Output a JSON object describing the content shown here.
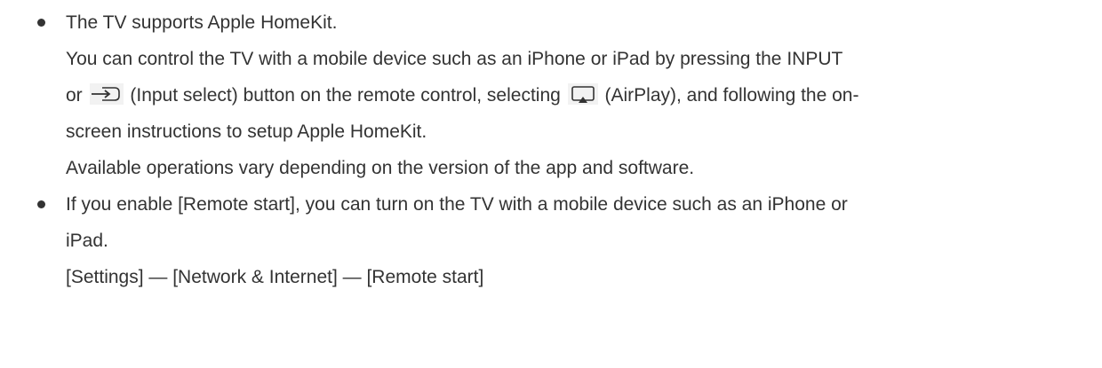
{
  "items": [
    {
      "lines": {
        "l1": "The TV supports Apple HomeKit.",
        "l2": "You can control the TV with a mobile device such as an iPhone or iPad by pressing the INPUT",
        "l3_a": "or",
        "l3_b": "(Input select) button on the remote control, selecting",
        "l3_c": "(AirPlay), and following the on-",
        "l4": "screen instructions to setup Apple HomeKit.",
        "l5": "Available operations vary depending on the version of the app and software."
      },
      "icons": {
        "input_select": "input-select-icon",
        "airplay": "airplay-icon"
      }
    },
    {
      "lines": {
        "l1": "If you enable [Remote start], you can turn on the TV with a mobile device such as an iPhone or",
        "l2": "iPad.",
        "l3": "[Settings] — [Network & Internet] — [Remote start]"
      }
    }
  ]
}
